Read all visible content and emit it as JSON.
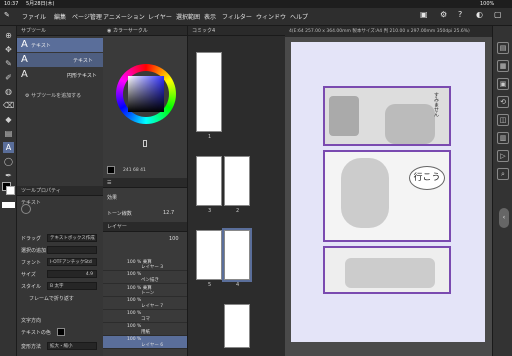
{
  "status": {
    "time": "10:37",
    "date": "5月28日(木)",
    "battery": "100%"
  },
  "menu": [
    "ファイル",
    "編集",
    "ページ管理",
    "アニメーション",
    "レイヤー",
    "選択範囲",
    "表示",
    "フィルター",
    "ウィンドウ",
    "ヘルプ"
  ],
  "subtool": {
    "header": "サブツール",
    "items": [
      {
        "label": "テキスト"
      },
      {
        "label": "テキスト"
      },
      {
        "label": "円形テキスト"
      }
    ],
    "add_label": "サブツールを追加する"
  },
  "color": {
    "header": "カラーサークル",
    "values": "241  68  41"
  },
  "toolprop": {
    "header": "ツールプロパティ",
    "subheader": "テキスト",
    "rows": [
      {
        "label": "ドラッグ",
        "value": "テキストボックス作成"
      },
      {
        "label": "選択の追加",
        "value": ""
      },
      {
        "label": "フォント",
        "value": "I-OTFアンチックStd"
      },
      {
        "label": "サイズ",
        "value": "4.9"
      },
      {
        "label": "スタイル",
        "value": "B 太字"
      },
      {
        "label": "フレームで折り返す",
        "value": ""
      },
      {
        "label": "文字方向",
        "value": ""
      },
      {
        "label": "テキストの色",
        "value": ""
      },
      {
        "label": "変形方法",
        "value": "拡大・縮小"
      }
    ]
  },
  "layer": {
    "header": "レイヤー",
    "effect_label": "効果",
    "tone_label": "トーン線数",
    "tone_value": "12.7",
    "opacity": "100",
    "rows": [
      {
        "label": "100 % 乗算",
        "name": "レイヤー 3"
      },
      {
        "label": "100 %",
        "name": "ペン描き"
      },
      {
        "label": "100 % 乗算",
        "name": "トーン"
      },
      {
        "label": "100 %",
        "name": "レイヤー 7"
      },
      {
        "label": "100 %",
        "name": "コマ"
      },
      {
        "label": "100 %",
        "name": "用紙"
      },
      {
        "label": "100 %",
        "name": "レイヤー 6"
      }
    ]
  },
  "pages": {
    "header": "コミック4",
    "numbers": [
      "1",
      "2",
      "3",
      "4",
      "5"
    ]
  },
  "canvas": {
    "tab": "4(E:64 257.00 x 364.00mm 製本サイズ:A4 判 210.00 x 297.00mm 350dpi 25.6%)"
  },
  "manga": {
    "bubble1": "すみません",
    "bubble2": "行こう"
  }
}
